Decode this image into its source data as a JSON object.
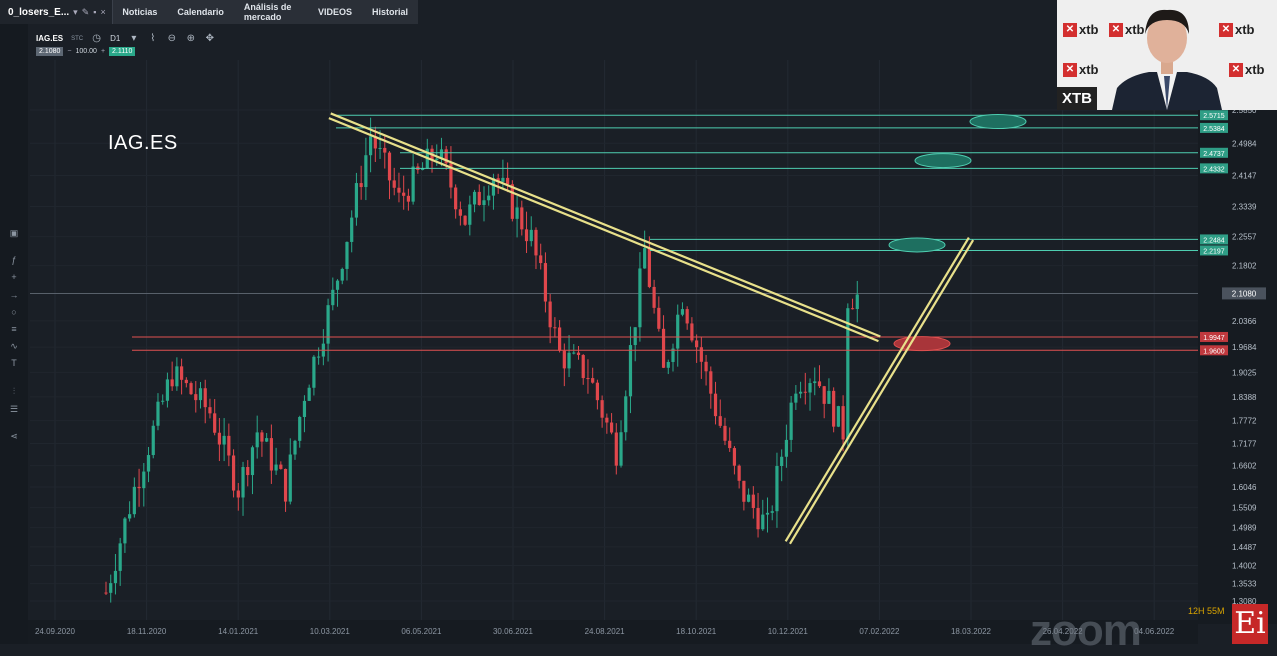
{
  "topbar": {
    "workspace_tab": "0_losers_E...",
    "nav": [
      "Noticias",
      "Calendario",
      "Análisis de mercado",
      "VIDEOS",
      "Historial"
    ]
  },
  "toolbar": {
    "symbol": "IAG.ES",
    "instrument_type": "STC",
    "timeframe": "D1",
    "bid": "2.1080",
    "volume": "100.00",
    "ask": "2.1110"
  },
  "chart_label": "IAG.ES",
  "webcam": {
    "badge": "XTB",
    "logo_text": "xtb"
  },
  "timer": "12H 55M",
  "watermark": {
    "zoom": "zoom",
    "ei": "Ei"
  },
  "colors": {
    "bg": "#1a1f26",
    "bull": "#2aa88a",
    "bear": "#e0474c",
    "trendline": "#e8e08a",
    "support": "#e05050",
    "resistance": "#4ecdb0"
  },
  "chart_data": {
    "type": "candlestick",
    "x_ticks": [
      "24.09.2020",
      "18.11.2020",
      "14.01.2021",
      "10.03.2021",
      "06.05.2021",
      "30.06.2021",
      "24.08.2021",
      "18.10.2021",
      "10.12.2021",
      "07.02.2022",
      "18.03.2022",
      "26.04.2022",
      "04.06.2022"
    ],
    "y_ticks": [
      "2.5850",
      "2.4984",
      "2.4147",
      "2.3339",
      "2.2557",
      "2.1802",
      "2.1080",
      "2.0366",
      "1.9684",
      "1.9025",
      "1.8388",
      "1.7772",
      "1.7177",
      "1.6602",
      "1.6046",
      "1.5509",
      "1.4989",
      "1.4487",
      "1.4002",
      "1.3533",
      "1.3080"
    ],
    "ylim": [
      1.308,
      2.585
    ],
    "current_price": "2.1080",
    "price_levels": [
      {
        "label": "2.5715",
        "kind": "resistance"
      },
      {
        "label": "2.5384",
        "kind": "resistance"
      },
      {
        "label": "2.4737",
        "kind": "resistance"
      },
      {
        "label": "2.4332",
        "kind": "resistance"
      },
      {
        "label": "2.2484",
        "kind": "resistance"
      },
      {
        "label": "2.2197",
        "kind": "resistance"
      },
      {
        "label": "1.9947",
        "kind": "support"
      },
      {
        "label": "1.9600",
        "kind": "support"
      }
    ],
    "trendlines": [
      {
        "name": "descending",
        "from": [
          "10.03.2021",
          2.57
        ],
        "to": [
          "07.02.2022",
          1.99
        ]
      },
      {
        "name": "ascending",
        "from": [
          "10.12.2021",
          1.46
        ],
        "to": [
          "18.03.2022",
          2.25
        ]
      }
    ],
    "series": [
      {
        "segments": [
          [
            0,
            1.33,
            1.6
          ],
          [
            6,
            1.6,
            1.9
          ],
          [
            14,
            1.9,
            1.8
          ],
          [
            22,
            1.8,
            1.6
          ],
          [
            28,
            1.6,
            1.75
          ],
          [
            32,
            1.75,
            1.6
          ],
          [
            38,
            1.6,
            1.85
          ],
          [
            42,
            1.85,
            2.1
          ],
          [
            48,
            2.1,
            2.52
          ],
          [
            56,
            2.52,
            2.35
          ],
          [
            62,
            2.35,
            2.48
          ],
          [
            70,
            2.48,
            2.3
          ],
          [
            76,
            2.3,
            2.42
          ],
          [
            82,
            2.42,
            2.25
          ],
          [
            90,
            2.25,
            1.95
          ],
          [
            96,
            1.95,
            1.9
          ],
          [
            102,
            1.9,
            1.7
          ],
          [
            108,
            1.7,
            2.22
          ],
          [
            114,
            2.22,
            1.9
          ],
          [
            118,
            1.9,
            2.1
          ],
          [
            122,
            2.1,
            1.85
          ],
          [
            128,
            1.85,
            1.6
          ],
          [
            134,
            1.6,
            1.5
          ],
          [
            140,
            1.5,
            1.88
          ],
          [
            146,
            1.88,
            1.9
          ],
          [
            150,
            1.9,
            1.75
          ],
          [
            156,
            1.75,
            2.1
          ]
        ]
      }
    ]
  }
}
